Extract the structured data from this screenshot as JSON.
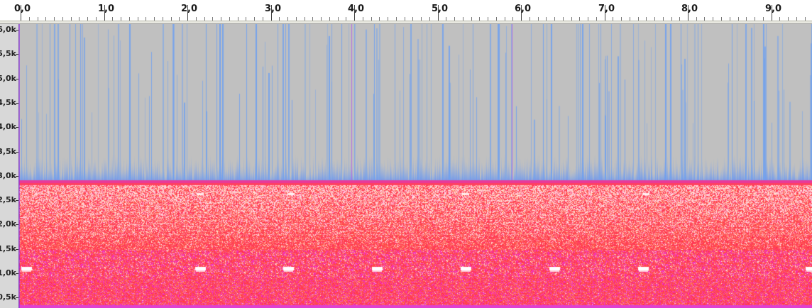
{
  "timeline": {
    "labels": [
      "0,0",
      "1,0",
      "2,0",
      "3,0",
      "4,0",
      "5,0",
      "6,0",
      "7,0",
      "8,0",
      "9,0"
    ]
  },
  "frequency_axis": {
    "labels": [
      "6,0k",
      "5,5k",
      "5,0k",
      "4,5k",
      "4,0k",
      "3,5k",
      "3,0k",
      "2,5k",
      "2,0k",
      "1,5k",
      "1,0k",
      "0,5k"
    ]
  },
  "colors": {
    "background_gray": "#c0c0c0",
    "low_energy_blue": "#6fa3f0",
    "energy_red": "#ff3050",
    "energy_magenta": "#f03ac8",
    "peak_white": "#ffffff"
  }
}
